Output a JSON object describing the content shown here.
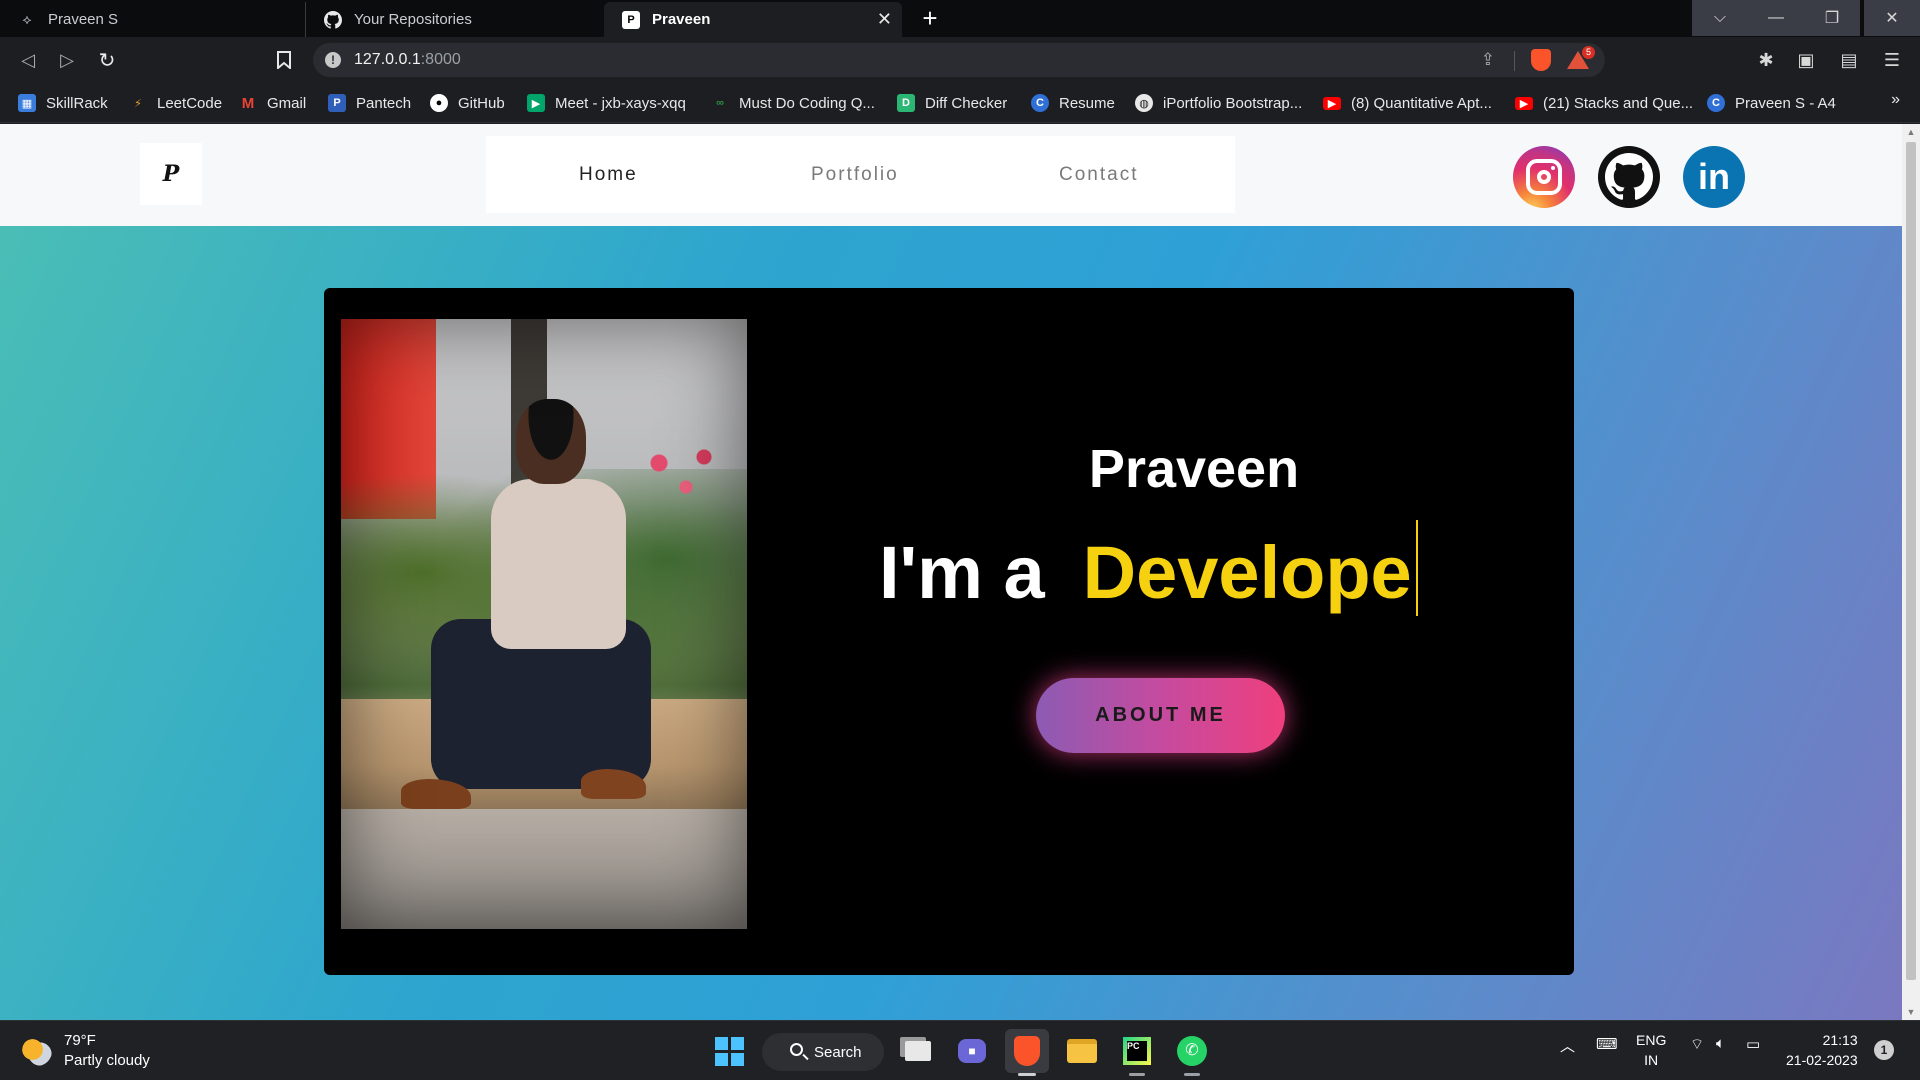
{
  "browser": {
    "tabs": [
      {
        "title": "Praveen S",
        "icon": "vscode-live-icon"
      },
      {
        "title": "Your Repositories",
        "icon": "github-icon"
      },
      {
        "title": "Praveen",
        "icon": "site-favicon",
        "active": true
      }
    ],
    "url_host": "127.0.0.1",
    "url_port": ":8000",
    "brave_badge": "5",
    "bookmarks": [
      {
        "label": "SkillRack",
        "color": "#3b7ddd"
      },
      {
        "label": "LeetCode",
        "color": "#f0a030"
      },
      {
        "label": "Gmail",
        "color": "#ea4335"
      },
      {
        "label": "Pantech",
        "color": "#2f5fb8"
      },
      {
        "label": "GitHub",
        "color": "#ffffff"
      },
      {
        "label": "Meet - jxb-xays-xqq",
        "color": "#00a56a"
      },
      {
        "label": "Must Do Coding Q...",
        "color": "#2f8d46"
      },
      {
        "label": "Diff Checker",
        "color": "#2bb673"
      },
      {
        "label": "Resume",
        "color": "#2f6fd6"
      },
      {
        "label": "iPortfolio Bootstrap...",
        "color": "#e8e8e8"
      },
      {
        "label": "(8) Quantitative Apt...",
        "color": "#ff0000"
      },
      {
        "label": "(21) Stacks and Que...",
        "color": "#ff0000"
      },
      {
        "label": "Praveen S - A4",
        "color": "#2f6fd6"
      }
    ],
    "bookmarks_more": "»"
  },
  "site": {
    "logo_text": "P",
    "nav": [
      {
        "label": "Home",
        "active": true
      },
      {
        "label": "Portfolio",
        "active": false
      },
      {
        "label": "Contact",
        "active": false
      }
    ],
    "social": [
      {
        "name": "instagram-icon"
      },
      {
        "name": "github-icon"
      },
      {
        "name": "linkedin-icon",
        "text": "in"
      }
    ],
    "hero": {
      "name": "Praveen",
      "prefix": "I'm a",
      "role_typed": "Develope",
      "button": "ABOUT ME"
    },
    "colors": {
      "accent_yellow": "#f6d10f",
      "button_start": "#8c5bb3",
      "button_end": "#ef3f7d"
    }
  },
  "taskbar": {
    "weather_temp": "79°F",
    "weather_desc": "Partly cloudy",
    "search_label": "Search",
    "lang_top": "ENG",
    "lang_bottom": "IN",
    "time": "21:13",
    "date": "21-02-2023",
    "notifications": "1"
  }
}
